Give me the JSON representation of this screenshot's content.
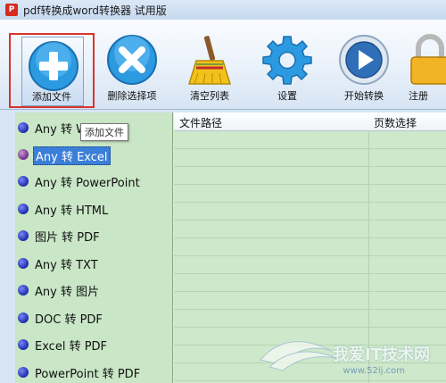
{
  "window": {
    "title": "pdf转换成word转换器 试用版",
    "icon_text": "P"
  },
  "toolbar": {
    "add_file": "添加文件",
    "delete_selected": "删除选择项",
    "clear_list": "清空列表",
    "settings": "设置",
    "start_convert": "开始转换",
    "register": "注册"
  },
  "tooltip": {
    "text": "添加文件"
  },
  "conversions": [
    {
      "label": "Any 转 Word",
      "selected": false
    },
    {
      "label": "Any 转 Excel",
      "selected": true
    },
    {
      "label": "Any 转 PowerPoint",
      "selected": false
    },
    {
      "label": "Any 转 HTML",
      "selected": false
    },
    {
      "label": "图片 转 PDF",
      "selected": false
    },
    {
      "label": "Any 转 TXT",
      "selected": false
    },
    {
      "label": "Any 转 图片",
      "selected": false
    },
    {
      "label": "DOC 转 PDF",
      "selected": false
    },
    {
      "label": "Excel 转 PDF",
      "selected": false
    },
    {
      "label": "PowerPoint 转 PDF",
      "selected": false
    }
  ],
  "file_table": {
    "columns": [
      "文件路径",
      "页数选择"
    ]
  },
  "watermark": {
    "text": "我爱IT技术网",
    "url": "www.52ij.com"
  },
  "colors": {
    "accent_blue": "#2c9ae0",
    "highlight": "#3a7fd8",
    "grid_bg": "#cde8cb",
    "outline_red": "#d9342b"
  }
}
